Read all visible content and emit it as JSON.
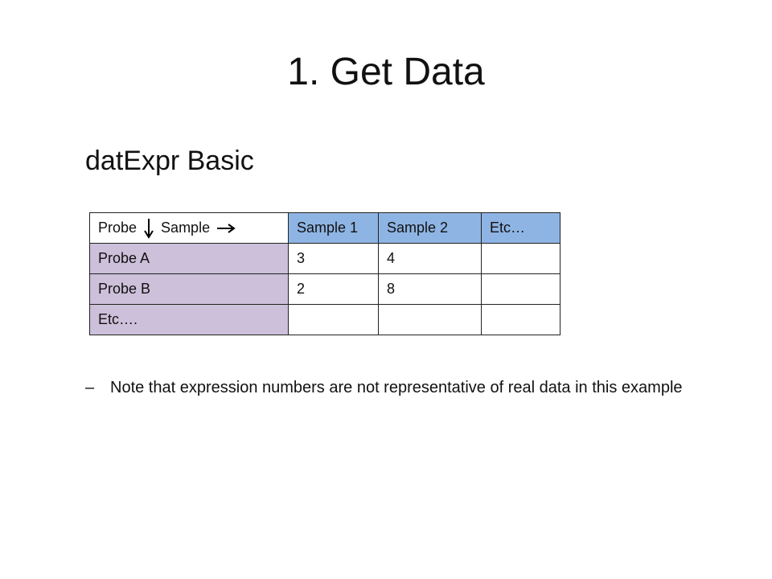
{
  "slide": {
    "title": "1. Get Data",
    "subtitle": "datExpr Basic",
    "colors": {
      "header_blue": "#8eb4e3",
      "row_purple": "#ccc0da"
    },
    "table": {
      "corner": {
        "probe": "Probe",
        "sample": "Sample",
        "down_icon": "arrow-down-icon",
        "right_icon": "arrow-right-icon"
      },
      "headers": [
        "Sample 1",
        "Sample 2",
        "Etc…"
      ],
      "rows": [
        {
          "label": "Probe A",
          "cells": [
            "3",
            "4",
            ""
          ]
        },
        {
          "label": "Probe B",
          "cells": [
            "2",
            "8",
            ""
          ]
        },
        {
          "label": "Etc….",
          "cells": [
            "",
            "",
            ""
          ]
        }
      ]
    },
    "note": {
      "bullet": "–",
      "text": "Note that expression numbers are not representative of real data in this example"
    }
  }
}
